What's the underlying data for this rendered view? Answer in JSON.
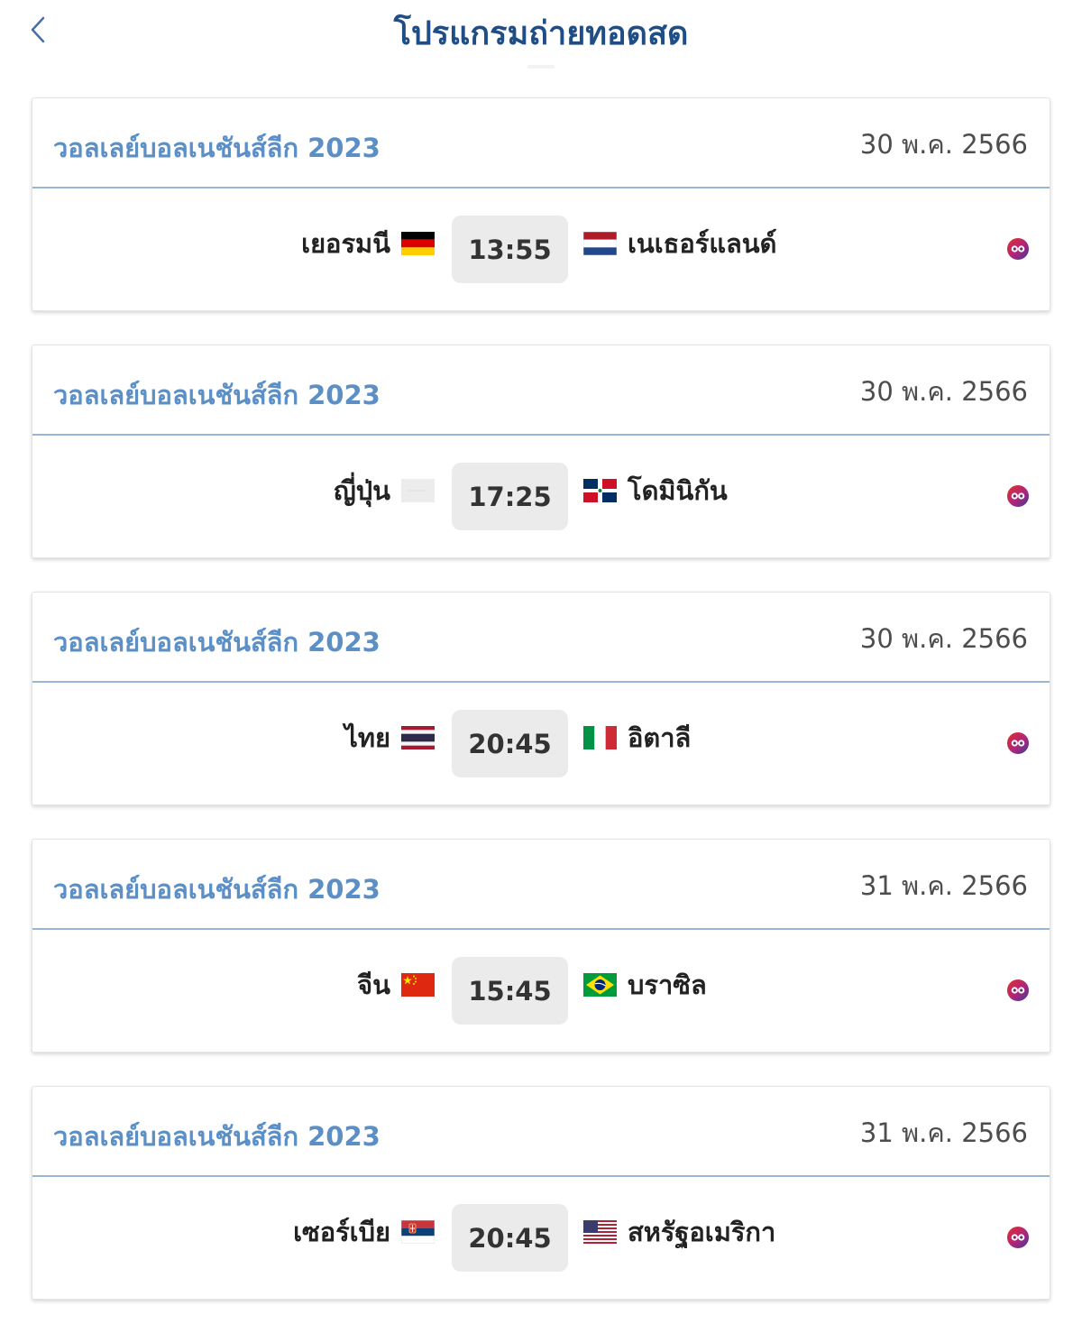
{
  "header": {
    "title": "โปรแกรมถ่ายทอดสด",
    "back_icon": "chevron-left-icon"
  },
  "colors": {
    "title": "#1f4e87",
    "league": "#5b8fc6",
    "divider": "#9ab6d6",
    "time_bg": "#ebebeb"
  },
  "matches": [
    {
      "league": "วอลเลย์บอลเนชันส์ลีก 2023",
      "date": "30 พ.ค. 2566",
      "home": "เยอรมนี",
      "home_flag": "germany-flag-icon",
      "time": "13:55",
      "away": "เนเธอร์แลนด์",
      "away_flag": "netherlands-flag-icon",
      "channel_icon": "channel-logo-icon"
    },
    {
      "league": "วอลเลย์บอลเนชันส์ลีก 2023",
      "date": "30 พ.ค. 2566",
      "home": "ญี่ปุ่น",
      "home_flag": "japan-flag-placeholder-icon",
      "time": "17:25",
      "away": "โดมินิกัน",
      "away_flag": "dominican-republic-flag-icon",
      "channel_icon": "channel-logo-icon"
    },
    {
      "league": "วอลเลย์บอลเนชันส์ลีก 2023",
      "date": "30 พ.ค. 2566",
      "home": "ไทย",
      "home_flag": "thailand-flag-icon",
      "time": "20:45",
      "away": "อิตาลี",
      "away_flag": "italy-flag-icon",
      "channel_icon": "channel-logo-icon"
    },
    {
      "league": "วอลเลย์บอลเนชันส์ลีก 2023",
      "date": "31 พ.ค. 2566",
      "home": "จีน",
      "home_flag": "china-flag-icon",
      "time": "15:45",
      "away": "บราซิล",
      "away_flag": "brazil-flag-icon",
      "channel_icon": "channel-logo-icon"
    },
    {
      "league": "วอลเลย์บอลเนชันส์ลีก 2023",
      "date": "31 พ.ค. 2566",
      "home": "เซอร์เบีย",
      "home_flag": "serbia-flag-icon",
      "time": "20:45",
      "away": "สหรัฐอเมริกา",
      "away_flag": "usa-flag-icon",
      "channel_icon": "channel-logo-icon"
    }
  ]
}
